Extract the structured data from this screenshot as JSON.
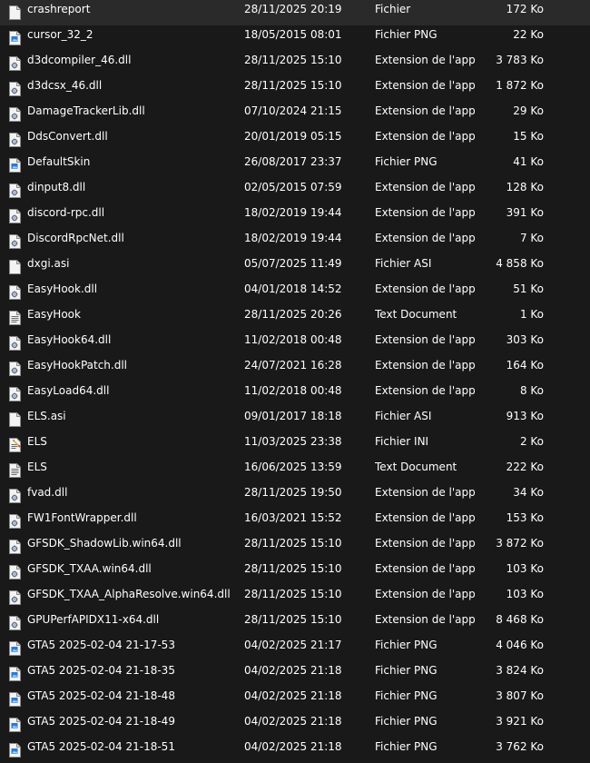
{
  "files": [
    {
      "name": "crashreport",
      "date": "28/11/2025 20:19",
      "type": "Fichier",
      "size": "172 Ko",
      "icon": "generic-file-icon"
    },
    {
      "name": "cursor_32_2",
      "date": "18/05/2015 08:01",
      "type": "Fichier PNG",
      "size": "22 Ko",
      "icon": "png-file-icon"
    },
    {
      "name": "d3dcompiler_46.dll",
      "date": "28/11/2025 15:10",
      "type": "Extension de l'app...",
      "size": "3 783 Ko",
      "icon": "dll-file-icon"
    },
    {
      "name": "d3dcsx_46.dll",
      "date": "28/11/2025 15:10",
      "type": "Extension de l'app...",
      "size": "1 872 Ko",
      "icon": "dll-file-icon"
    },
    {
      "name": "DamageTrackerLib.dll",
      "date": "07/10/2024 21:15",
      "type": "Extension de l'app...",
      "size": "29 Ko",
      "icon": "dll-file-icon"
    },
    {
      "name": "DdsConvert.dll",
      "date": "20/01/2019 05:15",
      "type": "Extension de l'app...",
      "size": "15 Ko",
      "icon": "dll-file-icon"
    },
    {
      "name": "DefaultSkin",
      "date": "26/08/2017 23:37",
      "type": "Fichier PNG",
      "size": "41 Ko",
      "icon": "png-file-icon"
    },
    {
      "name": "dinput8.dll",
      "date": "02/05/2015 07:59",
      "type": "Extension de l'app...",
      "size": "128 Ko",
      "icon": "dll-file-icon"
    },
    {
      "name": "discord-rpc.dll",
      "date": "18/02/2019 19:44",
      "type": "Extension de l'app...",
      "size": "391 Ko",
      "icon": "dll-file-icon"
    },
    {
      "name": "DiscordRpcNet.dll",
      "date": "18/02/2019 19:44",
      "type": "Extension de l'app...",
      "size": "7 Ko",
      "icon": "dll-file-icon"
    },
    {
      "name": "dxgi.asi",
      "date": "05/07/2025 11:49",
      "type": "Fichier ASI",
      "size": "4 858 Ko",
      "icon": "generic-file-icon"
    },
    {
      "name": "EasyHook.dll",
      "date": "04/01/2018 14:52",
      "type": "Extension de l'app...",
      "size": "51 Ko",
      "icon": "dll-file-icon"
    },
    {
      "name": "EasyHook",
      "date": "28/11/2025 20:26",
      "type": "Text Document",
      "size": "1 Ko",
      "icon": "text-file-icon"
    },
    {
      "name": "EasyHook64.dll",
      "date": "11/02/2018 00:48",
      "type": "Extension de l'app...",
      "size": "303 Ko",
      "icon": "dll-file-icon"
    },
    {
      "name": "EasyHookPatch.dll",
      "date": "24/07/2021 16:28",
      "type": "Extension de l'app...",
      "size": "164 Ko",
      "icon": "dll-file-icon"
    },
    {
      "name": "EasyLoad64.dll",
      "date": "11/02/2018 00:48",
      "type": "Extension de l'app...",
      "size": "8 Ko",
      "icon": "dll-file-icon"
    },
    {
      "name": "ELS.asi",
      "date": "09/01/2017 18:18",
      "type": "Fichier ASI",
      "size": "913 Ko",
      "icon": "generic-file-icon"
    },
    {
      "name": "ELS",
      "date": "11/03/2025 23:38",
      "type": "Fichier INI",
      "size": "2 Ko",
      "icon": "ini-file-icon"
    },
    {
      "name": "ELS",
      "date": "16/06/2025 13:59",
      "type": "Text Document",
      "size": "222 Ko",
      "icon": "text-file-icon"
    },
    {
      "name": "fvad.dll",
      "date": "28/11/2025 19:50",
      "type": "Extension de l'app...",
      "size": "34 Ko",
      "icon": "dll-file-icon"
    },
    {
      "name": "FW1FontWrapper.dll",
      "date": "16/03/2021 15:52",
      "type": "Extension de l'app...",
      "size": "153 Ko",
      "icon": "dll-file-icon"
    },
    {
      "name": "GFSDK_ShadowLib.win64.dll",
      "date": "28/11/2025 15:10",
      "type": "Extension de l'app...",
      "size": "3 872 Ko",
      "icon": "dll-file-icon"
    },
    {
      "name": "GFSDK_TXAA.win64.dll",
      "date": "28/11/2025 15:10",
      "type": "Extension de l'app...",
      "size": "103 Ko",
      "icon": "dll-file-icon"
    },
    {
      "name": "GFSDK_TXAA_AlphaResolve.win64.dll",
      "date": "28/11/2025 15:10",
      "type": "Extension de l'app...",
      "size": "103 Ko",
      "icon": "dll-file-icon"
    },
    {
      "name": "GPUPerfAPIDX11-x64.dll",
      "date": "28/11/2025 15:10",
      "type": "Extension de l'app...",
      "size": "8 468 Ko",
      "icon": "dll-file-icon"
    },
    {
      "name": "GTA5 2025-02-04 21-17-53",
      "date": "04/02/2025 21:17",
      "type": "Fichier PNG",
      "size": "4 046 Ko",
      "icon": "png-file-icon"
    },
    {
      "name": "GTA5 2025-02-04 21-18-35",
      "date": "04/02/2025 21:18",
      "type": "Fichier PNG",
      "size": "3 824 Ko",
      "icon": "png-file-icon"
    },
    {
      "name": "GTA5 2025-02-04 21-18-48",
      "date": "04/02/2025 21:18",
      "type": "Fichier PNG",
      "size": "3 807 Ko",
      "icon": "png-file-icon"
    },
    {
      "name": "GTA5 2025-02-04 21-18-49",
      "date": "04/02/2025 21:18",
      "type": "Fichier PNG",
      "size": "3 921 Ko",
      "icon": "png-file-icon"
    },
    {
      "name": "GTA5 2025-02-04 21-18-51",
      "date": "04/02/2025 21:18",
      "type": "Fichier PNG",
      "size": "3 762 Ko",
      "icon": "png-file-icon"
    }
  ]
}
